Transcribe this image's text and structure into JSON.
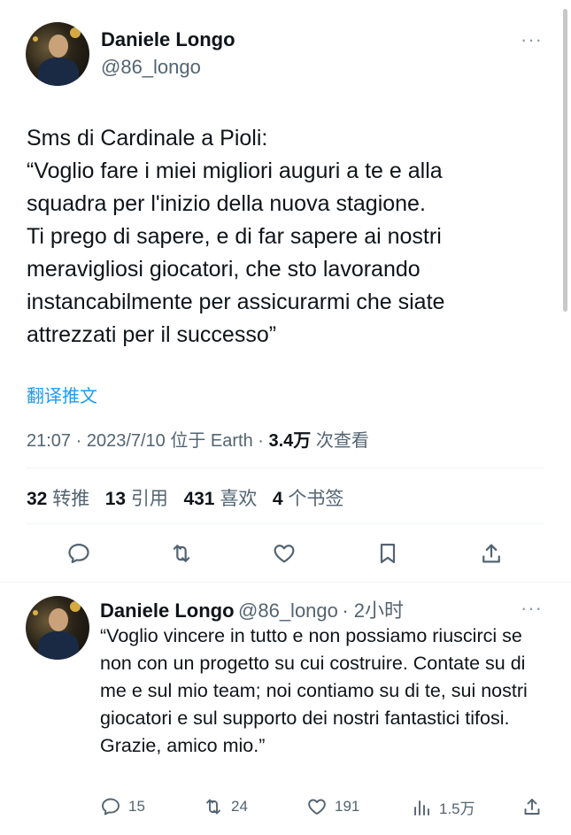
{
  "tweet": {
    "author_name": "Daniele Longo",
    "author_handle": "@86_longo",
    "more": "···",
    "text": "Sms di Cardinale a Pioli:\n“Voglio fare i miei migliori auguri a te e alla squadra per l'inizio della nuova stagione.\nTi prego di sapere, e di far sapere ai nostri meravigliosi giocatori, che sto lavorando instancabilmente per assicurarmi che siate attrezzati per il successo”",
    "translate_label": "翻译推文",
    "time": "21:07 · 2023/7/10 位于 Earth · ",
    "views_count": "3.4万",
    "views_label": " 次查看",
    "stats": {
      "retweets_count": "32",
      "retweets_label": "转推",
      "quotes_count": "13",
      "quotes_label": "引用",
      "likes_count": "431",
      "likes_label": "喜欢",
      "bookmarks_count": "4",
      "bookmarks_label": "个书签"
    },
    "actions": [
      "reply-icon",
      "retweet-icon",
      "like-icon",
      "bookmark-icon",
      "share-icon"
    ]
  },
  "reply": {
    "author_name": "Daniele Longo",
    "author_handle": "@86_longo",
    "time": "· 2小时",
    "more": "···",
    "text": "“Voglio vincere in tutto e non possiamo riuscirci se non con un progetto su cui costruire. Contate su di me e sul mio team; noi contiamo su di te, sui nostri giocatori e sul supporto dei nostri fantastici tifosi.\nGrazie, amico mio.”",
    "replies": "15",
    "retweets": "24",
    "likes": "191",
    "views": "1.5万"
  },
  "colors": {
    "text": "#0f1419",
    "secondary": "#536471",
    "link": "#1d9bf0",
    "divider": "#eff3f4"
  }
}
